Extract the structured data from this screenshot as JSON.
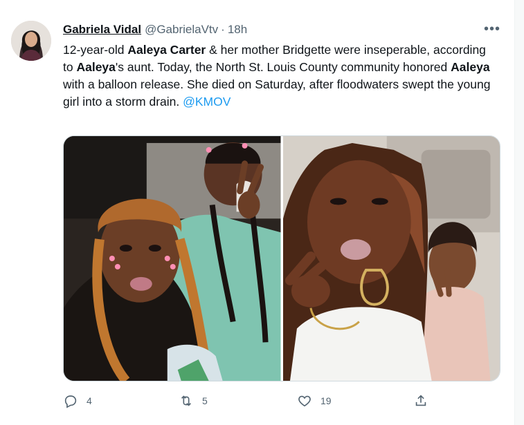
{
  "tweet": {
    "author_name": "Gabriela Vidal",
    "handle": "@GabrielaVtv",
    "separator": "·",
    "time": "18h",
    "more_icon": "more-horizontal-icon",
    "more_label": "•••",
    "text": {
      "p1": "12-year-old ",
      "b1": "Aaleya Carter",
      "p2": " & her mother Bridgette were inseperable, according to ",
      "b2": "Aaleya",
      "p3": "'s aunt. Today, the North St. Louis County community honored ",
      "b3": "Aaleya",
      "p4": " with a balloon release. She died on Saturday, after floodwaters swept the young girl into a storm drain. ",
      "mention": "@KMOV"
    },
    "media": {
      "count": 2
    },
    "actions": {
      "reply_count": "4",
      "retweet_count": "5",
      "like_count": "19"
    }
  },
  "colors": {
    "link": "#1d9bf0",
    "text": "#0f1419",
    "secondary": "#536471"
  }
}
